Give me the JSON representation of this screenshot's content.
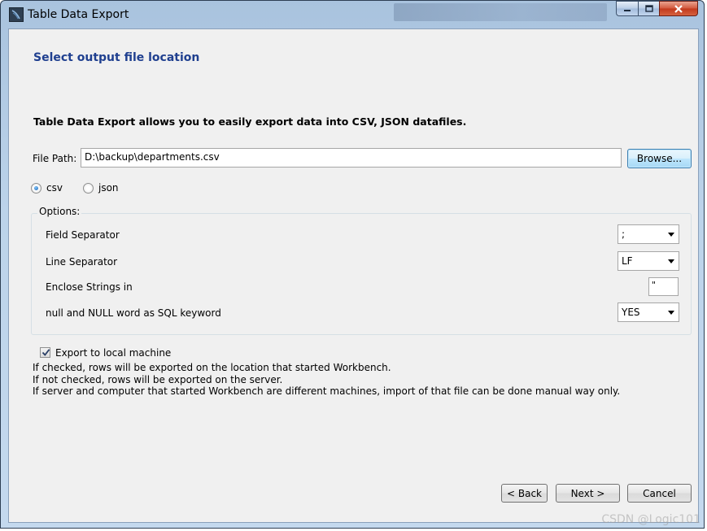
{
  "window": {
    "title": "Table Data Export"
  },
  "page": {
    "heading": "Select output file location",
    "description": "Table Data Export allows you to easily export data into CSV, JSON datafiles."
  },
  "file": {
    "label": "File Path:",
    "value": "D:\\backup\\departments.csv",
    "browse_label": "Browse..."
  },
  "format": {
    "options": [
      {
        "label": "csv",
        "checked": true
      },
      {
        "label": "json",
        "checked": false
      }
    ]
  },
  "options": {
    "group_label": "Options:",
    "field_separator": {
      "label": "Field Separator",
      "value": ";"
    },
    "line_separator": {
      "label": "Line Separator",
      "value": "LF"
    },
    "enclose_strings": {
      "label": "Enclose Strings in",
      "value": "\""
    },
    "null_keyword": {
      "label": "null and NULL word as SQL keyword",
      "value": "YES"
    }
  },
  "export_local": {
    "label": "Export to local machine",
    "checked": true,
    "notes": [
      "If checked, rows will be exported on the location that started Workbench.",
      "If not checked, rows will be exported on the server.",
      "If server and computer that started Workbench are different machines, import of that file can be done manual way only."
    ]
  },
  "buttons": {
    "back": "< Back",
    "next": "Next >",
    "cancel": "Cancel"
  },
  "watermark": "CSDN @Logic101",
  "colors": {
    "heading": "#1f3f8f",
    "dialog_bg": "#f0f0f0",
    "default_button_border": "#3c7fb1"
  },
  "icons": {
    "app": "mysql-workbench-dolphin-icon",
    "minimize": "minimize-icon",
    "maximize": "maximize-icon",
    "close": "close-icon",
    "dropdown": "chevron-down-icon",
    "checkmark": "checkmark-icon"
  }
}
